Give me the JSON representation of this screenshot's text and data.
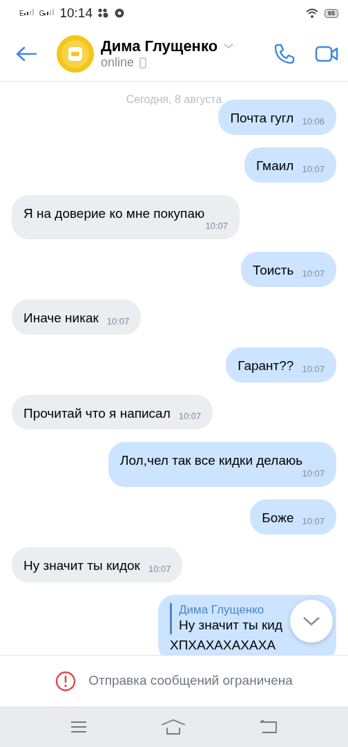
{
  "status_bar": {
    "network_1": "E",
    "network_2": "G",
    "time": "10:14",
    "battery": "65"
  },
  "header": {
    "name": "Дима Глущенко",
    "status": "online"
  },
  "date_divider": "Сегодня, 8 августа",
  "messages": [
    {
      "kind": "text",
      "outgoing": true,
      "text": "Почта гугл",
      "time": "10:06"
    },
    {
      "kind": "text",
      "outgoing": true,
      "text": "Гмаил",
      "time": "10:07"
    },
    {
      "kind": "text",
      "outgoing": false,
      "text": "Я на доверие ко мне покупаю",
      "time": "10:07"
    },
    {
      "kind": "text",
      "outgoing": true,
      "text": "Тоисть",
      "time": "10:07"
    },
    {
      "kind": "text",
      "outgoing": false,
      "text": "Иначе никак",
      "time": "10:07"
    },
    {
      "kind": "text",
      "outgoing": true,
      "text": "Гарант??",
      "time": "10:07"
    },
    {
      "kind": "text",
      "outgoing": false,
      "text": "Прочитай что я написал",
      "time": "10:07"
    },
    {
      "kind": "text",
      "outgoing": true,
      "text": "Лол,чел так все кидки делаюь",
      "time": "10:07"
    },
    {
      "kind": "text",
      "outgoing": true,
      "text": "Боже",
      "time": "10:07"
    },
    {
      "kind": "text",
      "outgoing": false,
      "text": "Ну значит ты кидок",
      "time": "10:07"
    },
    {
      "kind": "reply",
      "outgoing": true,
      "reply_author": "Дима Глущенко",
      "reply_text": "Ну значит ты кид",
      "text": "ХПХАХАХАХАХА"
    }
  ],
  "notice": "Отправка сообщений ограничена"
}
